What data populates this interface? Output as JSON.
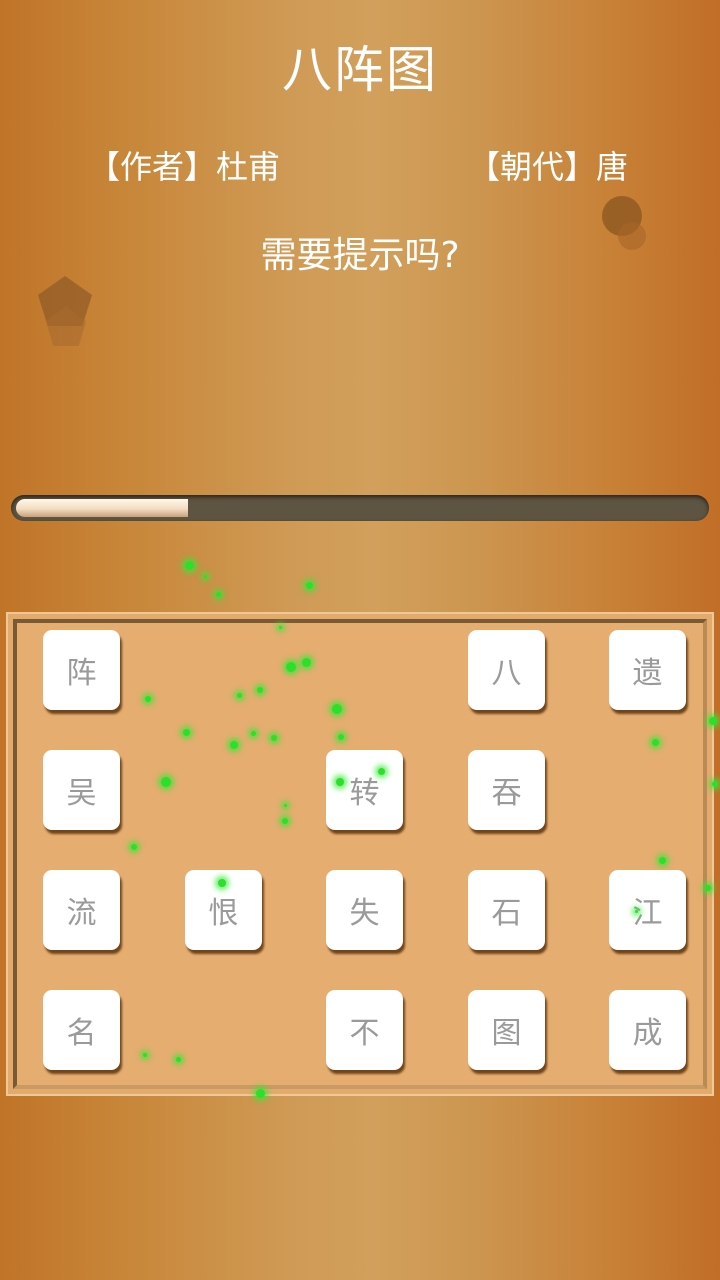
{
  "header": {
    "title": "八阵图",
    "author": "【作者】杜甫",
    "dynasty": "【朝代】唐",
    "hint_prompt": "需要提示吗?"
  },
  "progress": {
    "fraction": 0.25
  },
  "board": {
    "tiles": [
      {
        "char": "阵",
        "row": 0,
        "col": 0
      },
      {
        "char": "八",
        "row": 0,
        "col": 3
      },
      {
        "char": "遗",
        "row": 0,
        "col": 4
      },
      {
        "char": "吴",
        "row": 1,
        "col": 0
      },
      {
        "char": "转",
        "row": 1,
        "col": 2
      },
      {
        "char": "吞",
        "row": 1,
        "col": 3
      },
      {
        "char": "流",
        "row": 2,
        "col": 0
      },
      {
        "char": "恨",
        "row": 2,
        "col": 1
      },
      {
        "char": "失",
        "row": 2,
        "col": 2
      },
      {
        "char": "石",
        "row": 2,
        "col": 3
      },
      {
        "char": "江",
        "row": 2,
        "col": 4
      },
      {
        "char": "名",
        "row": 3,
        "col": 0
      },
      {
        "char": "不",
        "row": 3,
        "col": 2
      },
      {
        "char": "图",
        "row": 3,
        "col": 3
      },
      {
        "char": "成",
        "row": 3,
        "col": 4
      }
    ]
  },
  "colors": {
    "particle": "#2be02b",
    "tile_text": "#9a9a9a",
    "board": "#e6ad70"
  }
}
